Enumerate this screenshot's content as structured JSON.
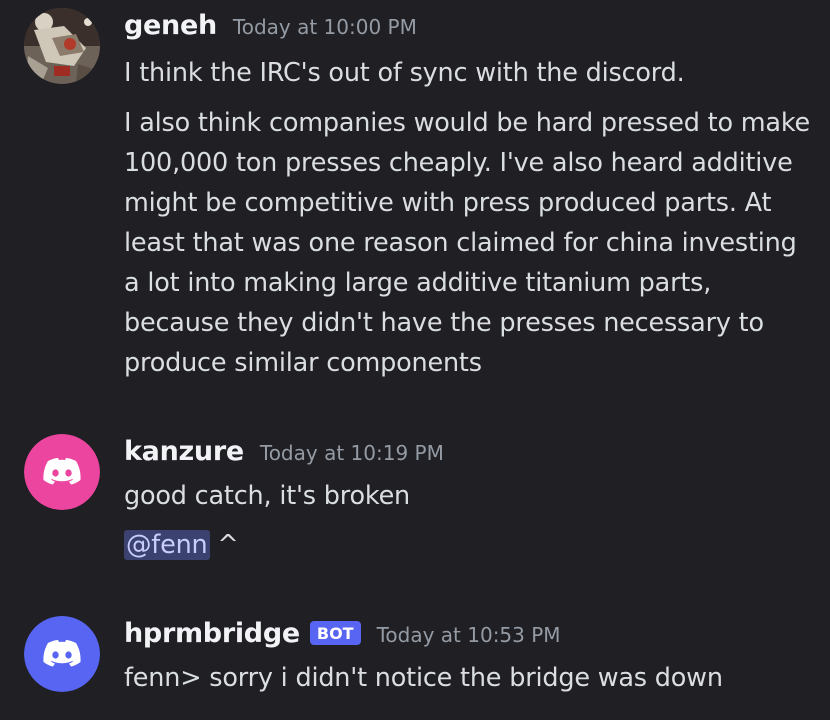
{
  "messages": [
    {
      "username": "geneh",
      "timestamp": "Today at 10:00 PM",
      "avatar_icon": "astronaut-photo-avatar",
      "lines": [
        "I think the IRC's out of sync with the discord.",
        "I also think companies would be hard pressed to make 100,000 ton presses cheaply. I've also heard additive might be competitive with press produced parts. At least that was one reason claimed for china investing a lot into making large additive titanium parts, because they didn't have the presses necessary to produce similar components"
      ]
    },
    {
      "username": "kanzure",
      "timestamp": "Today at 10:19 PM",
      "avatar_icon": "discord-logo-avatar",
      "avatar_color": "#eb459f",
      "lines": [
        "good catch, it's broken"
      ],
      "mention": "@fenn",
      "mention_suffix": " ^"
    },
    {
      "username": "hprmbridge",
      "badge": "BOT",
      "timestamp": "Today at 10:53 PM",
      "avatar_icon": "discord-logo-avatar",
      "avatar_color": "#5865f2",
      "lines": [
        "fenn> sorry i didn't notice the bridge was down"
      ]
    }
  ],
  "colors": {
    "background": "#1f1f24",
    "username": "#f2f3f5",
    "timestamp": "#949ba4",
    "message_text": "#dbdee1",
    "mention_bg": "#3c4270",
    "bot_badge": "#5865f2"
  }
}
